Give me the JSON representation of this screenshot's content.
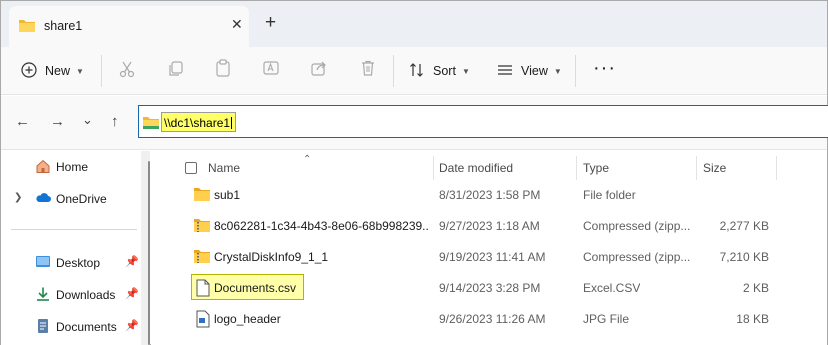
{
  "tab": {
    "title": "share1",
    "close": "✕",
    "new": "+"
  },
  "toolbar": {
    "new_label": "New",
    "sort_label": "Sort",
    "view_label": "View",
    "more": "···"
  },
  "nav": {
    "back": "←",
    "forward": "→",
    "recent": "⌄",
    "up": "↑"
  },
  "address": {
    "path": "\\\\dc1\\share1"
  },
  "sidebar": {
    "items": [
      {
        "label": "Home",
        "icon": "home-icon",
        "expandable": false,
        "pinned": false
      },
      {
        "label": "OneDrive",
        "icon": "cloud-icon",
        "expandable": true,
        "pinned": false
      },
      {
        "label": "Desktop",
        "icon": "desktop-icon",
        "expandable": false,
        "pinned": true
      },
      {
        "label": "Downloads",
        "icon": "download-icon",
        "expandable": false,
        "pinned": true
      },
      {
        "label": "Documents",
        "icon": "documents-icon",
        "expandable": false,
        "pinned": true
      }
    ]
  },
  "columns": {
    "name": "Name",
    "date": "Date modified",
    "type": "Type",
    "size": "Size"
  },
  "files": [
    {
      "name": "sub1",
      "date": "8/31/2023 1:58 PM",
      "type": "File folder",
      "size": "",
      "icon": "folder-icon"
    },
    {
      "name": "8c062281-1c34-4b43-8e06-68b998239...",
      "date": "9/27/2023 1:18 AM",
      "type": "Compressed (zipp...",
      "size": "2,277 KB",
      "icon": "zip-folder-icon"
    },
    {
      "name": "CrystalDiskInfo9_1_1",
      "date": "9/19/2023 11:41 AM",
      "type": "Compressed (zipp...",
      "size": "7,210 KB",
      "icon": "zip-folder-icon"
    },
    {
      "name": "Documents.csv",
      "date": "9/14/2023 3:28 PM",
      "type": "Excel.CSV",
      "size": "2 KB",
      "icon": "csv-file-icon",
      "highlighted": true
    },
    {
      "name": "logo_header",
      "date": "9/26/2023 11:26 AM",
      "type": "JPG File",
      "size": "18 KB",
      "icon": "image-file-icon"
    }
  ],
  "colors": {
    "accent": "#1767b0",
    "highlight": "#ffff66",
    "folder": "#f5c542"
  }
}
